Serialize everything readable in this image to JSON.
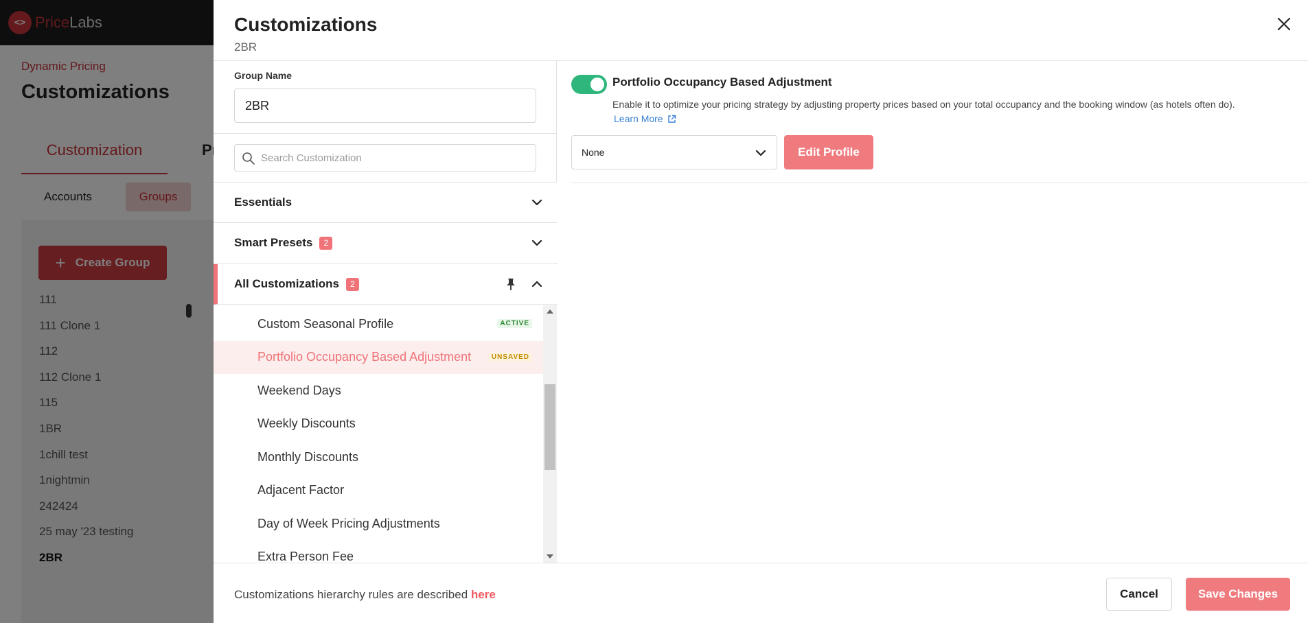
{
  "app": {
    "logo_mark": "<>",
    "logo_price": "Price",
    "logo_labs": "Labs"
  },
  "background": {
    "breadcrumb": "Dynamic Pricing",
    "title": "Customizations",
    "tab_customization": "Customization",
    "tab_other": "Pr",
    "sub_accounts": "Accounts",
    "sub_groups": "Groups",
    "create_group": "Create Group",
    "groups": [
      "111",
      "111 Clone 1",
      "112",
      "112 Clone 1",
      "115",
      "1BR",
      "1chill test",
      "1nightmin",
      "242424",
      "25 may '23 testing",
      "2BR"
    ],
    "selected_group": "2BR"
  },
  "drawer": {
    "title": "Customizations",
    "subtitle": "2BR",
    "group_name_label": "Group Name",
    "group_name_value": "2BR",
    "search_placeholder": "Search Customization",
    "sections": {
      "essentials": {
        "label": "Essentials"
      },
      "smart_presets": {
        "label": "Smart Presets",
        "badge": "2"
      },
      "all_customizations": {
        "label": "All Customizations",
        "badge": "2"
      }
    },
    "items": [
      {
        "label": "Custom Seasonal Profile",
        "status": "ACTIVE"
      },
      {
        "label": "Portfolio Occupancy Based Adjustment",
        "status": "UNSAVED"
      },
      {
        "label": "Weekend Days",
        "status": ""
      },
      {
        "label": "Weekly Discounts",
        "status": ""
      },
      {
        "label": "Monthly Discounts",
        "status": ""
      },
      {
        "label": "Adjacent Factor",
        "status": ""
      },
      {
        "label": "Day of Week Pricing Adjustments",
        "status": ""
      },
      {
        "label": "Extra Person Fee",
        "status": ""
      }
    ],
    "detail": {
      "toggle_on": true,
      "title": "Portfolio Occupancy Based Adjustment",
      "description": "Enable it to optimize your pricing strategy by adjusting property prices based on your total occupancy and the booking window (as hotels often do).",
      "learn_more": "Learn More",
      "select_value": "None",
      "edit_profile": "Edit Profile"
    },
    "footer": {
      "text": "Customizations hierarchy rules are described ",
      "link": "here",
      "cancel": "Cancel",
      "save": "Save Changes"
    }
  },
  "colors": {
    "brand_red": "#c8323a",
    "accent": "#f07b7f",
    "toggle_green": "#2eb67d",
    "link_blue": "#3b82d6"
  }
}
